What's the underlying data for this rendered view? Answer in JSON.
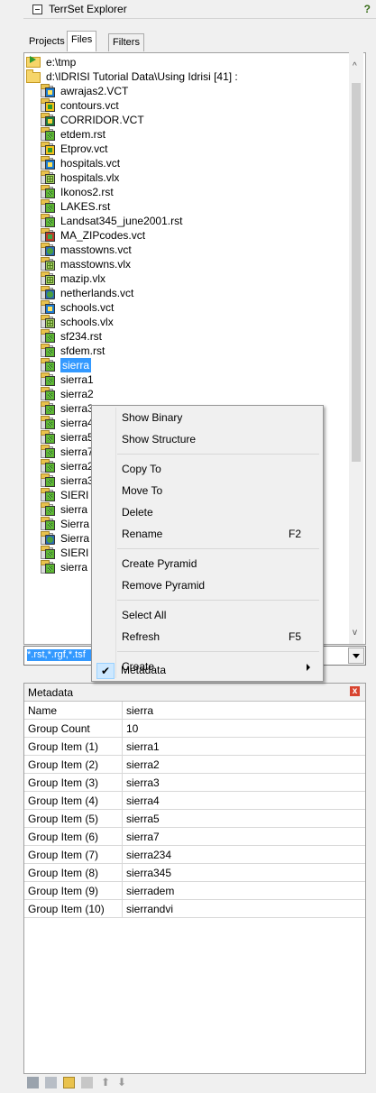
{
  "window": {
    "title": "TerrSet Explorer",
    "help": "?"
  },
  "tabs": [
    {
      "label": "Projects"
    },
    {
      "label": "Files"
    },
    {
      "label": "Filters"
    }
  ],
  "tree": {
    "root1": "e:\\tmp",
    "root2": "d:\\IDRISI Tutorial Data\\Using Idrisi [41] :",
    "files": [
      {
        "name": "awrajas2.VCT",
        "icon": "vct"
      },
      {
        "name": "contours.vct",
        "icon": "yl"
      },
      {
        "name": "CORRIDOR.VCT",
        "icon": "cor"
      },
      {
        "name": "etdem.rst",
        "icon": "rst"
      },
      {
        "name": "Etprov.vct",
        "icon": "yl"
      },
      {
        "name": "hospitals.vct",
        "icon": "vct"
      },
      {
        "name": "hospitals.vlx",
        "icon": "vlx"
      },
      {
        "name": "Ikonos2.rst",
        "icon": "rst"
      },
      {
        "name": "LAKES.rst",
        "icon": "rst"
      },
      {
        "name": "Landsat345_june2001.rst",
        "icon": "rst"
      },
      {
        "name": "MA_ZIPcodes.vct",
        "icon": "red"
      },
      {
        "name": "masstowns.vct",
        "icon": "glob"
      },
      {
        "name": "masstowns.vlx",
        "icon": "vlx"
      },
      {
        "name": "mazip.vlx",
        "icon": "vlx"
      },
      {
        "name": "netherlands.vct",
        "icon": "glob"
      },
      {
        "name": "schools.vct",
        "icon": "vct"
      },
      {
        "name": "schools.vlx",
        "icon": "vlx"
      },
      {
        "name": "sf234.rst",
        "icon": "rst"
      },
      {
        "name": "sfdem.rst",
        "icon": "rst"
      },
      {
        "name": "sierra",
        "icon": "rst"
      },
      {
        "name": "sierra1",
        "icon": "rst"
      },
      {
        "name": "sierra2",
        "icon": "rst"
      },
      {
        "name": "sierra3",
        "icon": "rst"
      },
      {
        "name": "sierra4",
        "icon": "rst"
      },
      {
        "name": "sierra5",
        "icon": "rst"
      },
      {
        "name": "sierra7",
        "icon": "rst"
      },
      {
        "name": "sierra2",
        "icon": "rst"
      },
      {
        "name": "sierra3",
        "icon": "rst"
      },
      {
        "name": "SIERI",
        "icon": "rst"
      },
      {
        "name": "sierra",
        "icon": "rst"
      },
      {
        "name": "Sierra",
        "icon": "rst"
      },
      {
        "name": "Sierra",
        "icon": "glob"
      },
      {
        "name": "SIERI",
        "icon": "rst"
      },
      {
        "name": "sierra",
        "icon": "rst"
      }
    ]
  },
  "filter": {
    "value": "*.rst,*.rgf,*.tsf"
  },
  "context_menu": {
    "show_binary": "Show Binary",
    "show_structure": "Show Structure",
    "copy_to": "Copy To",
    "move_to": "Move To",
    "delete": "Delete",
    "rename": "Rename",
    "rename_shortcut": "F2",
    "create_pyramid": "Create Pyramid",
    "remove_pyramid": "Remove Pyramid",
    "select_all": "Select All",
    "refresh": "Refresh",
    "refresh_shortcut": "F5",
    "create": "Create",
    "metadata": "Metadata"
  },
  "metadata": {
    "title": "Metadata",
    "close": "x",
    "rows": [
      {
        "key": "Name",
        "value": "sierra"
      },
      {
        "key": "Group Count",
        "value": "10"
      },
      {
        "key": "Group Item (1)",
        "value": "sierra1"
      },
      {
        "key": "Group Item (2)",
        "value": "sierra2"
      },
      {
        "key": "Group Item (3)",
        "value": "sierra3"
      },
      {
        "key": "Group Item (4)",
        "value": "sierra4"
      },
      {
        "key": "Group Item (5)",
        "value": "sierra5"
      },
      {
        "key": "Group Item (6)",
        "value": "sierra7"
      },
      {
        "key": "Group Item (7)",
        "value": "sierra234"
      },
      {
        "key": "Group Item (8)",
        "value": "sierra345"
      },
      {
        "key": "Group Item (9)",
        "value": "sierradem"
      },
      {
        "key": "Group Item (10)",
        "value": "sierrandvi"
      }
    ]
  },
  "colors": {
    "selection": "#3399ff",
    "menu_bg": "#f0f0f0",
    "close_red": "#d8442f"
  }
}
